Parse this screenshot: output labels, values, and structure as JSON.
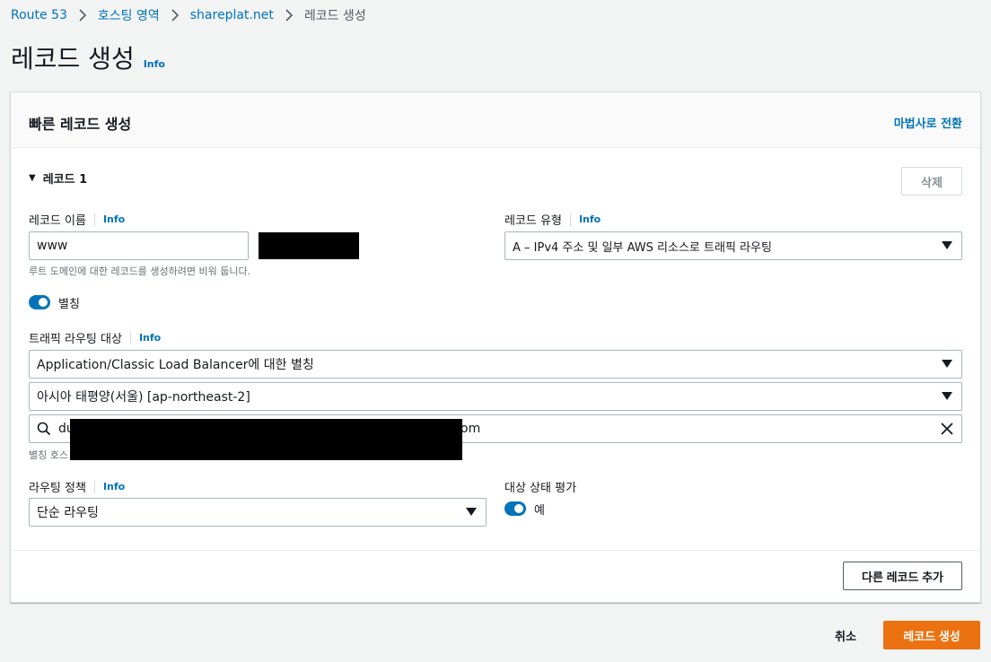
{
  "breadcrumb": [
    {
      "label": "Route 53"
    },
    {
      "label": "호스팅 영역"
    },
    {
      "label": "shareplat.net"
    },
    {
      "label": "레코드 생성"
    }
  ],
  "page": {
    "title": "레코드 생성",
    "info": "Info"
  },
  "panel": {
    "title": "빠른 레코드 생성",
    "wizard_link": "마법사로 전환",
    "record_header": "레코드 1",
    "delete_button": "삭제"
  },
  "record_name": {
    "label": "레코드 이름",
    "info": "Info",
    "value": "www",
    "helper": "루트 도메인에 대한 레코드를 생성하려면 비워 둡니다."
  },
  "record_type": {
    "label": "레코드 유형",
    "info": "Info",
    "value": "A – IPv4 주소 및 일부 AWS 리소스로 트래픽 라우팅"
  },
  "alias": {
    "label": "별칭",
    "enabled": true
  },
  "traffic_target": {
    "label": "트래픽 라우팅 대상",
    "info": "Info",
    "endpoint": "Application/Classic Load Balancer에 대한 별칭",
    "region": "아시아 태평양(서울) [ap-northeast-2]",
    "search_prefix": "du",
    "search_suffix": "om",
    "helper_prefix": "별칭 호스"
  },
  "routing_policy": {
    "label": "라우팅 정책",
    "info": "Info",
    "value": "단순 라우팅"
  },
  "health_eval": {
    "label": "대상 상태 평가",
    "toggle_label": "예",
    "enabled": true
  },
  "footer": {
    "add_record": "다른 레코드 추가",
    "cancel": "취소",
    "create": "레코드 생성"
  },
  "colors": {
    "link": "#0073bb",
    "primary_button": "#ec7211",
    "toggle_on": "#0073bb"
  }
}
